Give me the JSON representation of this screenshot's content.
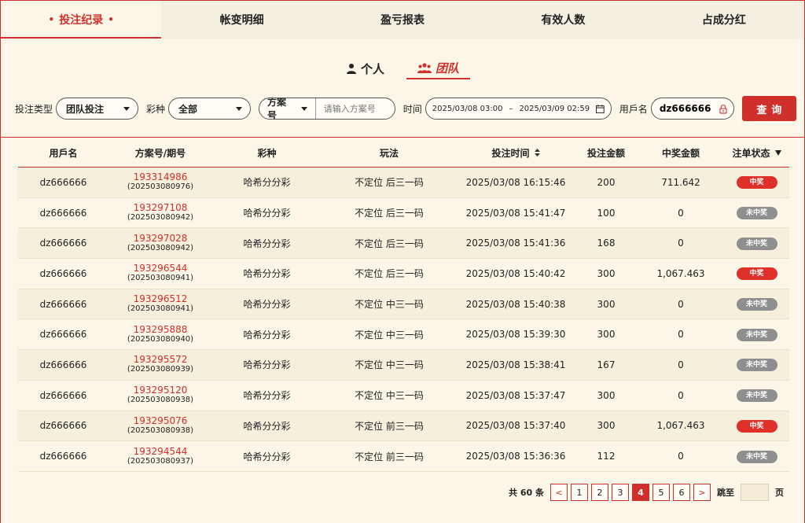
{
  "top_tabs": [
    "投注纪录",
    "帐变明细",
    "盈亏报表",
    "有效人数",
    "占成分红"
  ],
  "scope_tabs": [
    "个人",
    "团队"
  ],
  "filters": {
    "bet_type_label": "投注类型",
    "bet_type_value": "团队投注",
    "lottery_label": "彩种",
    "lottery_value": "全部",
    "plan_label": "方案号",
    "plan_placeholder": "请输入方案号",
    "time_label": "时间",
    "date_from": "2025/03/08 03:00",
    "date_sep": "–",
    "date_to": "2025/03/09 02:59",
    "user_label": "用戶名",
    "user_value": "dz666666",
    "query_label": "查询"
  },
  "table": {
    "headers": [
      "用戶名",
      "方案号/期号",
      "彩种",
      "玩法",
      "投注时间",
      "投注金额",
      "中奖金额",
      "注单状态"
    ],
    "rows": [
      {
        "user": "dz666666",
        "plan": "193314986",
        "issue": "(202503080976)",
        "lottery": "哈希分分彩",
        "play": "不定位 后三一码",
        "time": "2025/03/08 16:15:46",
        "amount": "200",
        "win": "711.642",
        "status": "中奖",
        "won": true
      },
      {
        "user": "dz666666",
        "plan": "193297108",
        "issue": "(202503080942)",
        "lottery": "哈希分分彩",
        "play": "不定位 后三一码",
        "time": "2025/03/08 15:41:47",
        "amount": "100",
        "win": "0",
        "status": "未中奖",
        "won": false
      },
      {
        "user": "dz666666",
        "plan": "193297028",
        "issue": "(202503080942)",
        "lottery": "哈希分分彩",
        "play": "不定位 后三一码",
        "time": "2025/03/08 15:41:36",
        "amount": "168",
        "win": "0",
        "status": "未中奖",
        "won": false
      },
      {
        "user": "dz666666",
        "plan": "193296544",
        "issue": "(202503080941)",
        "lottery": "哈希分分彩",
        "play": "不定位 后三一码",
        "time": "2025/03/08 15:40:42",
        "amount": "300",
        "win": "1,067.463",
        "status": "中奖",
        "won": true
      },
      {
        "user": "dz666666",
        "plan": "193296512",
        "issue": "(202503080941)",
        "lottery": "哈希分分彩",
        "play": "不定位 中三一码",
        "time": "2025/03/08 15:40:38",
        "amount": "300",
        "win": "0",
        "status": "未中奖",
        "won": false
      },
      {
        "user": "dz666666",
        "plan": "193295888",
        "issue": "(202503080940)",
        "lottery": "哈希分分彩",
        "play": "不定位 中三一码",
        "time": "2025/03/08 15:39:30",
        "amount": "300",
        "win": "0",
        "status": "未中奖",
        "won": false
      },
      {
        "user": "dz666666",
        "plan": "193295572",
        "issue": "(202503080939)",
        "lottery": "哈希分分彩",
        "play": "不定位 中三一码",
        "time": "2025/03/08 15:38:41",
        "amount": "167",
        "win": "0",
        "status": "未中奖",
        "won": false
      },
      {
        "user": "dz666666",
        "plan": "193295120",
        "issue": "(202503080938)",
        "lottery": "哈希分分彩",
        "play": "不定位 中三一码",
        "time": "2025/03/08 15:37:47",
        "amount": "300",
        "win": "0",
        "status": "未中奖",
        "won": false
      },
      {
        "user": "dz666666",
        "plan": "193295076",
        "issue": "(202503080938)",
        "lottery": "哈希分分彩",
        "play": "不定位 前三一码",
        "time": "2025/03/08 15:37:40",
        "amount": "300",
        "win": "1,067.463",
        "status": "中奖",
        "won": true
      },
      {
        "user": "dz666666",
        "plan": "193294544",
        "issue": "(202503080937)",
        "lottery": "哈希分分彩",
        "play": "不定位 前三一码",
        "time": "2025/03/08 15:36:36",
        "amount": "112",
        "win": "0",
        "status": "未中奖",
        "won": false
      }
    ]
  },
  "pagination": {
    "total_text": "共 60 条",
    "pages": [
      "1",
      "2",
      "3",
      "4",
      "5",
      "6"
    ],
    "current": "4",
    "prev": "<",
    "next": ">",
    "jump_label": "跳至",
    "page_unit": "页"
  },
  "colors": {
    "accent": "#d0302c",
    "background": "#fbf6e7",
    "lose_badge": "#8f8f8f"
  },
  "icons": [
    "person-icon",
    "team-icon",
    "caret-down-icon",
    "calendar-icon",
    "lock-icon",
    "sort-icon",
    "filter-icon"
  ]
}
